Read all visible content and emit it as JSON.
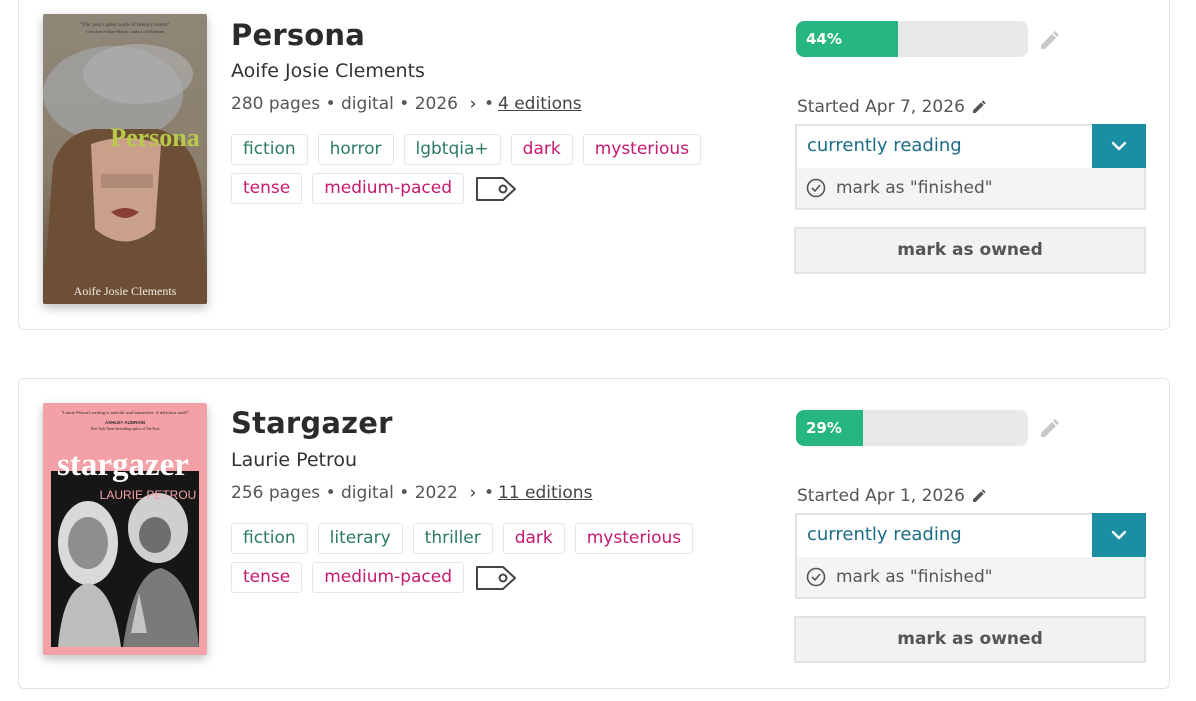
{
  "books": [
    {
      "title": "Persona",
      "author": "Aoife Josie Clements",
      "pages": "280 pages",
      "format": "digital",
      "year": "2026",
      "editions": "4 editions",
      "cover": {
        "blurb": "\"The year's great work of literary horror\"",
        "blurb_credit": "Gretchen Felker-Martin, author of Manhunt",
        "cover_title": "Persona",
        "cover_author": "Aoife Josie Clements"
      },
      "genre_tags": [
        "fiction",
        "horror",
        "lgbtqia+"
      ],
      "mood_tags": [
        "dark",
        "mysterious",
        "tense",
        "medium-paced"
      ],
      "progress_label": "44%",
      "progress": 0.44,
      "started": "Started Apr 7, 2026",
      "status": "currently reading",
      "finish_label": "mark as \"finished\"",
      "owned_label": "mark as owned"
    },
    {
      "title": "Stargazer",
      "author": "Laurie Petrou",
      "pages": "256 pages",
      "format": "digital",
      "year": "2022",
      "editions": "11 editions",
      "cover": {
        "blurb": "\"Laurie Petrou's writing is melodic and immersive. A delicious read!\"",
        "blurb_credit": "ASHLEY AUDRAIN",
        "blurb_credit2": "New York Times bestselling author of The Push",
        "cover_title": "stargazer",
        "cover_author": "LAURIE PETROU"
      },
      "genre_tags": [
        "fiction",
        "literary",
        "thriller"
      ],
      "mood_tags": [
        "dark",
        "mysterious",
        "tense",
        "medium-paced"
      ],
      "progress_label": "29%",
      "progress": 0.29,
      "started": "Started Apr 1, 2026",
      "status": "currently reading",
      "finish_label": "mark as \"finished\"",
      "owned_label": "mark as owned"
    }
  ],
  "colors": {
    "progress_fill": "#26b680",
    "genre_tag": "#2b7a66",
    "mood_tag": "#c6186f",
    "status_text": "#1b6c86",
    "dropdown_bg": "#1c8ea2"
  },
  "icons": {
    "pencil": "pencil-icon",
    "chevron_right": "chevron-right-icon",
    "chevron_down": "chevron-down-icon",
    "check_circle": "check-circle-icon",
    "tag": "tag-icon"
  }
}
